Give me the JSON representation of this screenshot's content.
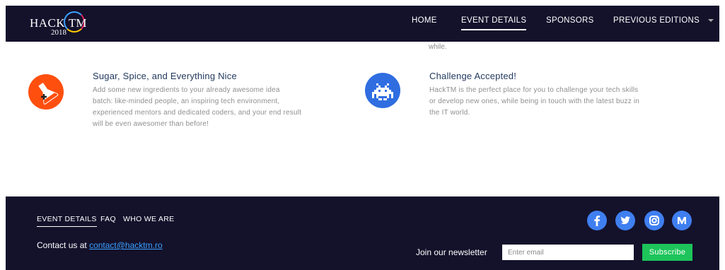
{
  "logo": {
    "word_left": "HACK",
    "word_right": "TM",
    "year": "2018"
  },
  "nav": {
    "items": [
      {
        "label": "HOME"
      },
      {
        "label": "EVENT DETAILS"
      },
      {
        "label": "SPONSORS"
      },
      {
        "label": "PREVIOUS EDITIONS"
      }
    ],
    "active_index": 1
  },
  "cut_text": "while.",
  "features": [
    {
      "icon": "flask-icon",
      "icon_color": "#ff4f0f",
      "title": "Sugar, Spice, and Everything Nice",
      "lines": [
        "Add some new ingredients to your already awesome idea",
        "batch: like-minded people, an inspiring tech environment,",
        "experienced mentors and dedicated coders, and your end result",
        "will be even awesomer than before!"
      ]
    },
    {
      "icon": "space-invader-icon",
      "icon_color": "#2f6de1",
      "title": "Challenge Accepted!",
      "lines": [
        "HackTM is the perfect place for you to challenge your tech skills",
        "or develop new ones, while being in touch with the latest buzz in",
        "the IT world."
      ]
    }
  ],
  "footer": {
    "links": [
      {
        "label": "EVENT DETAILS"
      },
      {
        "label": "FAQ"
      },
      {
        "label": "WHO WE ARE"
      }
    ],
    "contact_prefix": "Contact us at",
    "contact_email": "contact@hacktm.ro",
    "social": [
      "facebook-icon",
      "twitter-icon",
      "instagram-icon",
      "medium-icon"
    ],
    "newsletter_label": "Join our newsletter",
    "email_placeholder": "Enter email",
    "subscribe_label": "Subscribe"
  },
  "colors": {
    "navy": "#14112b",
    "social_blue": "#3f7ff0",
    "subscribe_green": "#1dc45a",
    "link_blue": "#3aa0ff"
  }
}
